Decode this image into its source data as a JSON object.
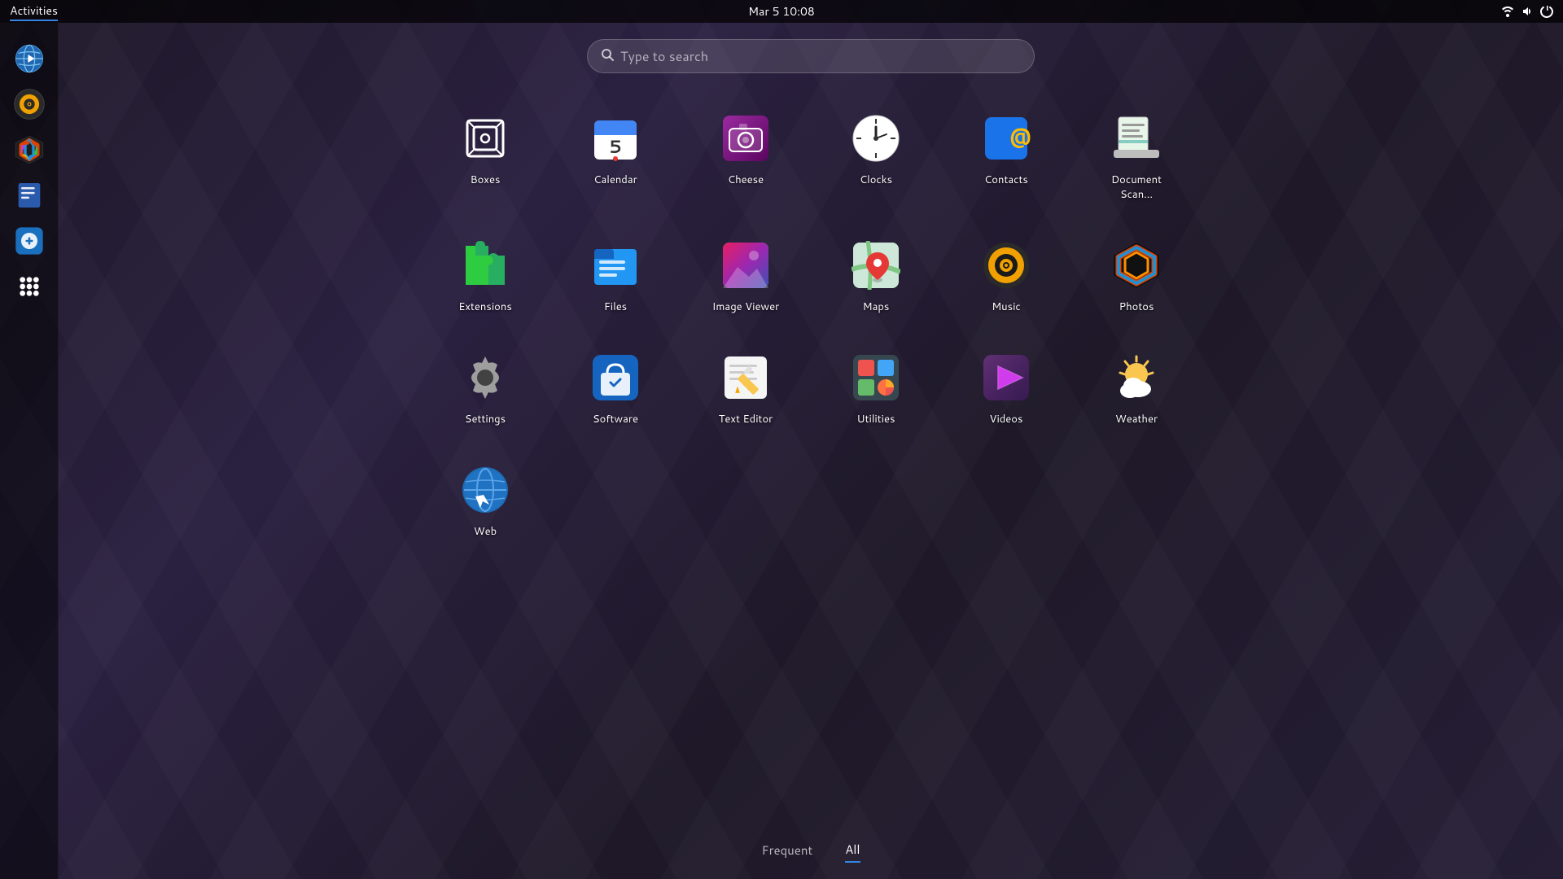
{
  "topbar": {
    "activities_label": "Activities",
    "datetime": "Mar 5  10:08"
  },
  "search": {
    "placeholder": "Type to search"
  },
  "sidebar": {
    "items": [
      {
        "id": "web-browser",
        "label": "Web Browser",
        "icon": "globe"
      },
      {
        "id": "rhythmbox",
        "label": "Rhythmbox",
        "icon": "music"
      },
      {
        "id": "photos",
        "label": "Photos",
        "icon": "hexagon-color"
      },
      {
        "id": "notes",
        "label": "Notes",
        "icon": "notes"
      },
      {
        "id": "software",
        "label": "Software",
        "icon": "software"
      },
      {
        "id": "app-grid",
        "label": "App Grid",
        "icon": "grid"
      }
    ]
  },
  "apps": [
    {
      "id": "boxes",
      "name": "Boxes",
      "icon": "boxes"
    },
    {
      "id": "calendar",
      "name": "Calendar",
      "icon": "calendar"
    },
    {
      "id": "cheese",
      "name": "Cheese",
      "icon": "cheese"
    },
    {
      "id": "clocks",
      "name": "Clocks",
      "icon": "clocks"
    },
    {
      "id": "contacts",
      "name": "Contacts",
      "icon": "contacts"
    },
    {
      "id": "document-scanner",
      "name": "Document Scan...",
      "icon": "document-scanner"
    },
    {
      "id": "extensions",
      "name": "Extensions",
      "icon": "extensions"
    },
    {
      "id": "files",
      "name": "Files",
      "icon": "files"
    },
    {
      "id": "image-viewer",
      "name": "Image Viewer",
      "icon": "image-viewer"
    },
    {
      "id": "maps",
      "name": "Maps",
      "icon": "maps"
    },
    {
      "id": "music",
      "name": "Music",
      "icon": "music-app"
    },
    {
      "id": "photos",
      "name": "Photos",
      "icon": "photos-app"
    },
    {
      "id": "settings",
      "name": "Settings",
      "icon": "settings"
    },
    {
      "id": "software",
      "name": "Software",
      "icon": "software-app"
    },
    {
      "id": "text-editor",
      "name": "Text Editor",
      "icon": "text-editor"
    },
    {
      "id": "utilities",
      "name": "Utilities",
      "icon": "utilities"
    },
    {
      "id": "videos",
      "name": "Videos",
      "icon": "videos"
    },
    {
      "id": "weather",
      "name": "Weather",
      "icon": "weather"
    },
    {
      "id": "web",
      "name": "Web",
      "icon": "web"
    }
  ],
  "tabs": [
    {
      "id": "frequent",
      "label": "Frequent",
      "active": false
    },
    {
      "id": "all",
      "label": "All",
      "active": true
    }
  ]
}
